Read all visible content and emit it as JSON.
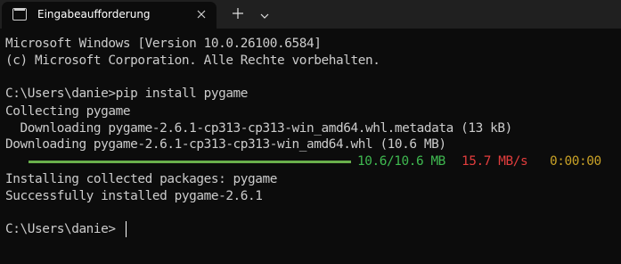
{
  "window": {
    "tab_title": "Eingabeaufforderung",
    "tab_icon": "cmd-icon",
    "new_tab_icon": "plus-icon",
    "dropdown_icon": "chevron-down-icon",
    "close_icon": "close-icon"
  },
  "terminal": {
    "lines": [
      "Microsoft Windows [Version 10.0.26100.6584]",
      "(c) Microsoft Corporation. Alle Rechte vorbehalten.",
      "",
      "C:\\Users\\danie>pip install pygame",
      "Collecting pygame",
      "  Downloading pygame-2.6.1-cp313-cp313-win_amd64.whl.metadata (13 kB)",
      "Downloading pygame-2.6.1-cp313-cp313-win_amd64.whl (10.6 MB)"
    ],
    "progress": {
      "fraction": 1.0,
      "size": "10.6/10.6 MB",
      "speed": "15.7 MB/s",
      "eta": "0:00:00",
      "colors": {
        "bar": "#6ab04c",
        "size": "#3fb950",
        "speed": "#e23d3d",
        "eta": "#c9a227"
      }
    },
    "after_lines": [
      "Installing collected packages: pygame",
      "Successfully installed pygame-2.6.1",
      "",
      "C:\\Users\\danie>"
    ]
  }
}
